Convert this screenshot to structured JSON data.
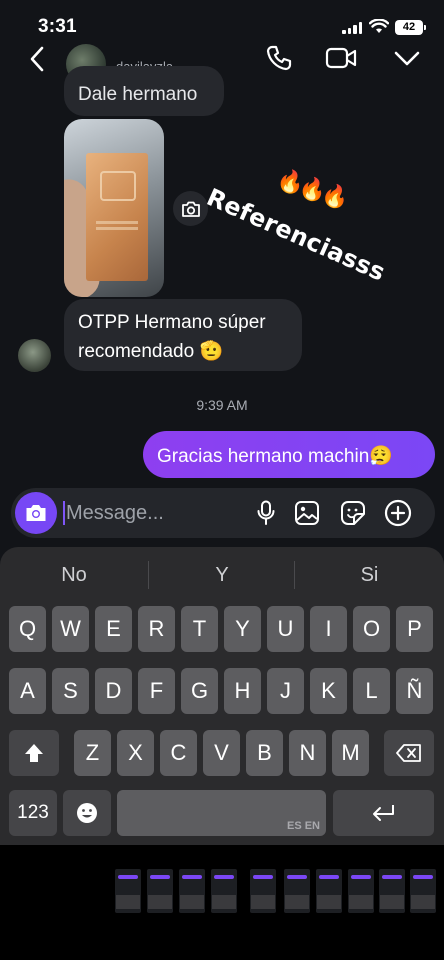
{
  "status_bar": {
    "time": "3:31",
    "battery": "42"
  },
  "header": {
    "username": "davilavzla"
  },
  "messages": {
    "partial_text": "Dale hermano",
    "sticker_text": "Referenciasss",
    "sticker_emoji": "🔥🔥🔥",
    "incoming_line1": "OTPP Hermano súper",
    "incoming_line2": "recomendado 🫡",
    "timestamp": "9:39 AM",
    "outgoing": "Gracias hermano machin😮‍💨"
  },
  "composer": {
    "placeholder": "Message..."
  },
  "keyboard": {
    "suggestions": [
      "No",
      "Y",
      "Si"
    ],
    "row1": [
      "Q",
      "W",
      "E",
      "R",
      "T",
      "Y",
      "U",
      "I",
      "O",
      "P"
    ],
    "row2": [
      "A",
      "S",
      "D",
      "F",
      "G",
      "H",
      "J",
      "K",
      "L",
      "Ñ"
    ],
    "row3": [
      "Z",
      "X",
      "C",
      "V",
      "B",
      "N",
      "M"
    ],
    "numbers_label": "123",
    "space_label": "ES EN"
  },
  "colors": {
    "accent": "#7747f5",
    "bubble_out": "#8e3ff0",
    "bubble_in": "#26282d",
    "background": "#121418"
  },
  "icons": [
    "back-icon",
    "phone-icon",
    "video-icon",
    "chevron-down-icon",
    "camera-icon",
    "microphone-icon",
    "gallery-icon",
    "sticker-icon",
    "plus-circle-icon",
    "shift-icon",
    "backspace-icon",
    "emoji-icon",
    "return-icon"
  ]
}
